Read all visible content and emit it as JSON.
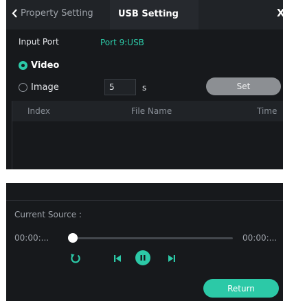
{
  "header": {
    "back_tab_label": "Property Setting",
    "active_tab_label": "USB Setting",
    "close_label": "X"
  },
  "input_port": {
    "label": "Input Port",
    "value": "Port 9:USB"
  },
  "media_type": {
    "selected": "Video",
    "video_label": "Video",
    "image_label": "Image"
  },
  "image_duration": {
    "value": "5",
    "unit": "s"
  },
  "set_button_label": "Set",
  "file_table": {
    "columns": [
      "Index",
      "File Name",
      "Time"
    ],
    "rows": []
  },
  "player": {
    "current_source_label": "Current Source :",
    "time_elapsed": "00:00:...",
    "time_total": "00:00:...",
    "progress": 0,
    "state": "playing"
  },
  "return_button_label": "Return",
  "icons": {
    "back": "chevron-left-icon",
    "close": "close-icon",
    "loop": "loop-icon",
    "previous": "skip-previous-icon",
    "pause": "pause-icon",
    "next": "skip-next-icon"
  },
  "colors": {
    "accent": "#2cc9a7",
    "panel_background": "#17191c",
    "header_background": "#202327",
    "set_button": "#8c8f93"
  }
}
